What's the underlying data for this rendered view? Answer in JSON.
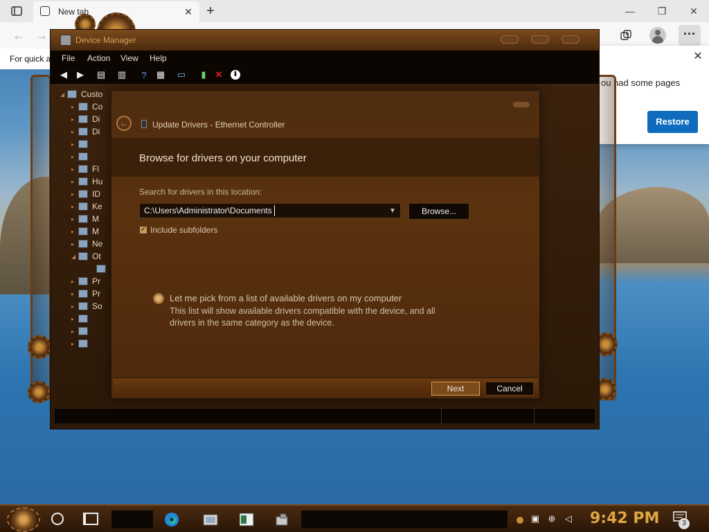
{
  "browser": {
    "tab_title": "New tab",
    "tab_close": "✕",
    "new_tab": "+",
    "minimize": "—",
    "restore_window": "❐",
    "close_window": "✕",
    "back": "←",
    "forward": "→",
    "more": "···",
    "infobar_text": "For quick a"
  },
  "restore_popup": {
    "message": "ou had some pages",
    "close": "✕",
    "button_label": "Restore"
  },
  "device_manager": {
    "title": "Device Manager",
    "menu": [
      "File",
      "Action",
      "View",
      "Help"
    ],
    "toolbar_icons": [
      "back-arrow-icon",
      "forward-arrow-icon",
      "properties-icon",
      "list-icon",
      "help-icon",
      "scan-hardware-icon",
      "monitor-icon",
      "enable-device-icon",
      "uninstall-icon",
      "update-driver-icon"
    ],
    "tree": [
      {
        "label": "Custo",
        "arrow": "◢"
      },
      {
        "label": "Co",
        "arrow": "▸"
      },
      {
        "label": "Di",
        "arrow": "▸"
      },
      {
        "label": "Di",
        "arrow": "▸"
      },
      {
        "label": "",
        "arrow": "▸"
      },
      {
        "label": "",
        "arrow": "▸"
      },
      {
        "label": "Fl",
        "arrow": "▸"
      },
      {
        "label": "Hu",
        "arrow": "▸"
      },
      {
        "label": "ID",
        "arrow": "▸"
      },
      {
        "label": "Ke",
        "arrow": "▸"
      },
      {
        "label": "M",
        "arrow": "▸"
      },
      {
        "label": "M",
        "arrow": "▸"
      },
      {
        "label": "Ne",
        "arrow": "▸"
      },
      {
        "label": "Ot",
        "arrow": "◢"
      },
      {
        "label": "",
        "arrow": ""
      },
      {
        "label": "Pr",
        "arrow": "▸"
      },
      {
        "label": "Pr",
        "arrow": "▸"
      },
      {
        "label": "So",
        "arrow": "▸"
      },
      {
        "label": "",
        "arrow": "▸"
      },
      {
        "label": "",
        "arrow": "▸"
      },
      {
        "label": "",
        "arrow": "▸"
      }
    ]
  },
  "dialog": {
    "back": "←",
    "header_title": "Update Drivers - Ethernet Controller",
    "heading": "Browse for drivers on your computer",
    "search_label": "Search for drivers in this location:",
    "path_value": "C:\\Users\\Administrator\\Documents",
    "dropdown_arrow": "▼",
    "browse_label": "Browse...",
    "include_subfolders_label": "Include subfolders",
    "include_subfolders_checked": true,
    "check_mark": "✓",
    "pick_title": "Let me pick from a list of available drivers on my computer",
    "pick_description": "This list will show available drivers compatible with the device, and all drivers in the same category as the device.",
    "next_label": "Next",
    "cancel_label": "Cancel"
  },
  "taskbar": {
    "apps": [
      "edge-icon",
      "explorer-icon",
      "app-window-icon",
      "device-manager-icon"
    ],
    "tray": [
      "meet-now-icon",
      "network-icon",
      "volume-muted-icon"
    ],
    "clock": "9:42 PM",
    "notification_count": "3"
  },
  "colors": {
    "accent_blue": "#0f6cbd",
    "copper": "#7a4a1c",
    "clock_gold": "#e0a840"
  }
}
